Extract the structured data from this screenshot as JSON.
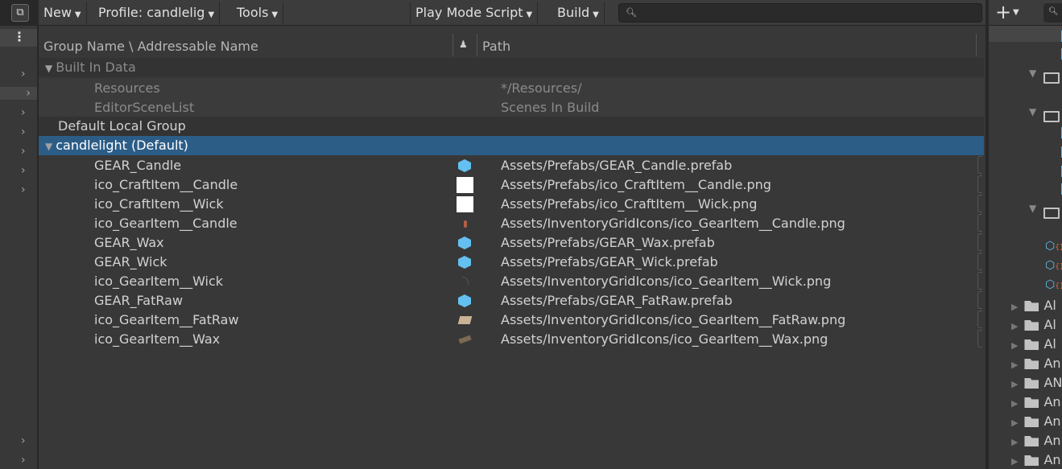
{
  "toolbar": {
    "new": "New",
    "profile": "Profile: candlelig",
    "tools": "Tools",
    "play_mode": "Play Mode Script",
    "build": "Build",
    "search_placeholder": ""
  },
  "columns": {
    "name": "Group Name \\ Addressable Name",
    "path": "Path"
  },
  "groups": [
    {
      "name": "Built In Data",
      "entries": [
        {
          "name": "Resources",
          "path": "*/Resources/"
        },
        {
          "name": "EditorSceneList",
          "path": "Scenes In Build"
        }
      ]
    },
    {
      "name": "Default Local Group"
    },
    {
      "name": "candlelight (Default)",
      "selected": true
    }
  ],
  "entries": [
    {
      "name": "GEAR_Candle",
      "icon": "prefab-cube-icon",
      "path": "Assets/Prefabs/GEAR_Candle.prefab"
    },
    {
      "name": "ico_CraftItem__Candle",
      "icon": "white-texture-icon",
      "path": "Assets/Prefabs/ico_CraftItem__Candle.png"
    },
    {
      "name": "ico_CraftItem__Wick",
      "icon": "white-texture-icon",
      "path": "Assets/Prefabs/ico_CraftItem__Wick.png"
    },
    {
      "name": "ico_GearItem__Candle",
      "icon": "candle-texture-icon",
      "path": "Assets/InventoryGridIcons/ico_GearItem__Candle.png"
    },
    {
      "name": "GEAR_Wax",
      "icon": "prefab-cube-icon",
      "path": "Assets/Prefabs/GEAR_Wax.prefab"
    },
    {
      "name": "GEAR_Wick",
      "icon": "prefab-cube-icon",
      "path": "Assets/Prefabs/GEAR_Wick.prefab"
    },
    {
      "name": "ico_GearItem__Wick",
      "icon": "wick-texture-icon",
      "path": "Assets/InventoryGridIcons/ico_GearItem__Wick.png"
    },
    {
      "name": "GEAR_FatRaw",
      "icon": "prefab-cube-icon",
      "path": "Assets/Prefabs/GEAR_FatRaw.prefab"
    },
    {
      "name": "ico_GearItem__FatRaw",
      "icon": "fat-texture-icon",
      "path": "Assets/InventoryGridIcons/ico_GearItem__FatRaw.png"
    },
    {
      "name": "ico_GearItem__Wax",
      "icon": "wax-texture-icon",
      "path": "Assets/InventoryGridIcons/ico_GearItem__Wax.png"
    }
  ],
  "project": {
    "folders": [
      "Al",
      "Al",
      "Al",
      "An",
      "AN",
      "An",
      "An",
      "An",
      "An"
    ]
  },
  "colors": {
    "selection": "#2c5d87",
    "prefab": "#64c0f0"
  }
}
